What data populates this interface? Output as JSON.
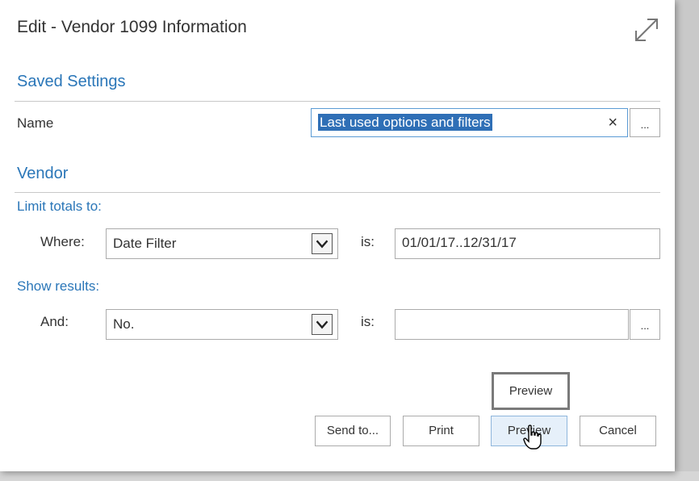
{
  "dialog": {
    "title": "Edit - Vendor 1099 Information"
  },
  "saved_settings": {
    "heading": "Saved Settings",
    "name_label": "Name",
    "name_value": "Last used options and filters",
    "clear_glyph": "×",
    "lookup_glyph": "..."
  },
  "vendor": {
    "heading": "Vendor",
    "limit_totals_label": "Limit totals to:",
    "where_label": "Where:",
    "where_field": "Date Filter",
    "is_label": "is:",
    "where_value": "01/01/17..12/31/17",
    "show_results_label": "Show results:",
    "and_label": "And:",
    "and_field": "No.",
    "and_is_label": "is:",
    "and_value": "",
    "lookup_glyph": "..."
  },
  "buttons": {
    "send_to": "Send to...",
    "print": "Print",
    "preview": "Preview",
    "cancel": "Cancel"
  },
  "tooltip": {
    "text": "Preview"
  },
  "colors": {
    "accent": "#2a76b8",
    "selection": "#2f6fb6"
  },
  "icons": {
    "expand": "expand-icon",
    "dropdown": "chevron-down-icon",
    "cursor": "hand-pointer-icon"
  }
}
